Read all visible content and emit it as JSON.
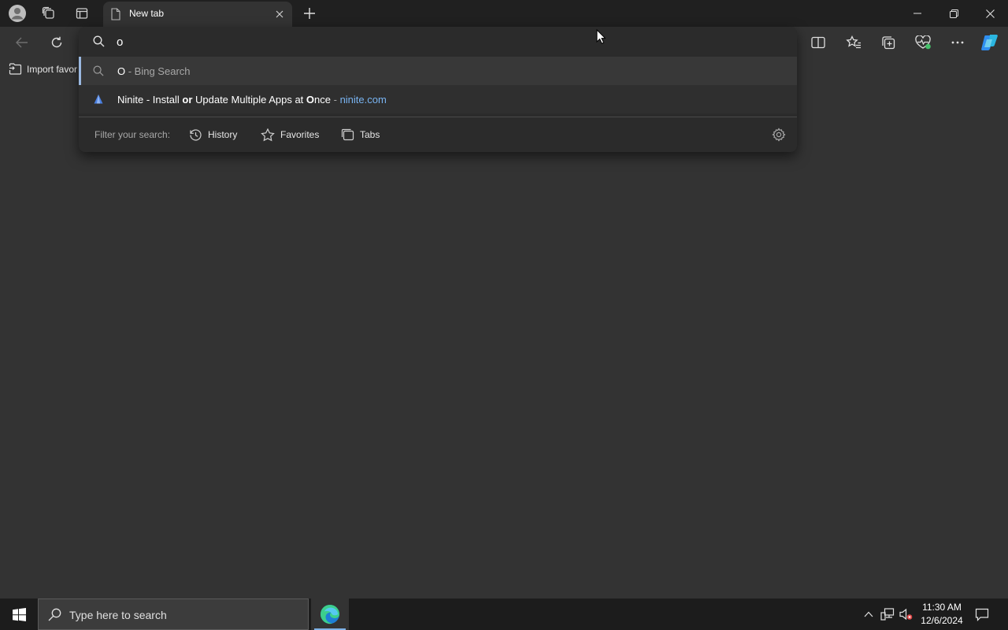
{
  "browser": {
    "tab": {
      "title": "New tab"
    },
    "favorites_bar": {
      "import_label": "Import favor"
    }
  },
  "omnibox": {
    "input_value": "o",
    "suggestions": [
      {
        "type": "search",
        "bold": "O",
        "rest": " - Bing Search",
        "icon": "search-icon"
      },
      {
        "type": "site",
        "parts": [
          "Ninite - Install ",
          "or",
          " Update Multiple Apps at ",
          "O",
          "nce"
        ],
        "separator": " - ",
        "url": "ninite.com",
        "icon": "ninite-favicon"
      }
    ],
    "filter": {
      "label": "Filter your search:",
      "chips": [
        {
          "label": "History",
          "icon": "history-icon"
        },
        {
          "label": "Favorites",
          "icon": "star-icon"
        },
        {
          "label": "Tabs",
          "icon": "tabs-icon"
        }
      ]
    }
  },
  "taskbar": {
    "search_placeholder": "Type here to search",
    "clock": {
      "time": "11:30 AM",
      "date": "12/6/2024"
    }
  },
  "colors": {
    "page_bg": "#333333",
    "titlebar_bg": "#202020",
    "omnibox_bg": "#2b2b2b",
    "link": "#79b4f2",
    "taskbar_bg": "#1c1c1c"
  }
}
